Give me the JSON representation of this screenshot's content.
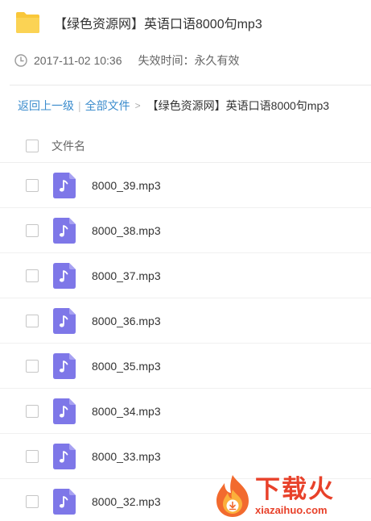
{
  "header": {
    "title": "【绿色资源网】英语口语8000句mp3",
    "icon": "folder-icon"
  },
  "meta": {
    "date": "2017-11-02 10:36",
    "expire_label": "失效时间：永久有效"
  },
  "breadcrumb": {
    "back_label": "返回上一级",
    "separator": "|",
    "all_files_label": "全部文件",
    "arrow": ">",
    "current_label": "【绿色资源网】英语口语8000句mp3"
  },
  "list": {
    "column_header": "文件名",
    "items": [
      {
        "name": "8000_39.mp3",
        "icon": "music-file-icon"
      },
      {
        "name": "8000_38.mp3",
        "icon": "music-file-icon"
      },
      {
        "name": "8000_37.mp3",
        "icon": "music-file-icon"
      },
      {
        "name": "8000_36.mp3",
        "icon": "music-file-icon"
      },
      {
        "name": "8000_35.mp3",
        "icon": "music-file-icon"
      },
      {
        "name": "8000_34.mp3",
        "icon": "music-file-icon"
      },
      {
        "name": "8000_33.mp3",
        "icon": "music-file-icon"
      },
      {
        "name": "8000_32.mp3",
        "icon": "music-file-icon"
      }
    ]
  },
  "watermark": {
    "brand": "下载火",
    "domain": "xiazaihuo.com"
  },
  "colors": {
    "folder": "#f9c73a",
    "file_icon": "#7e77e8",
    "link": "#3b8ccd",
    "watermark": "#e8412a"
  }
}
